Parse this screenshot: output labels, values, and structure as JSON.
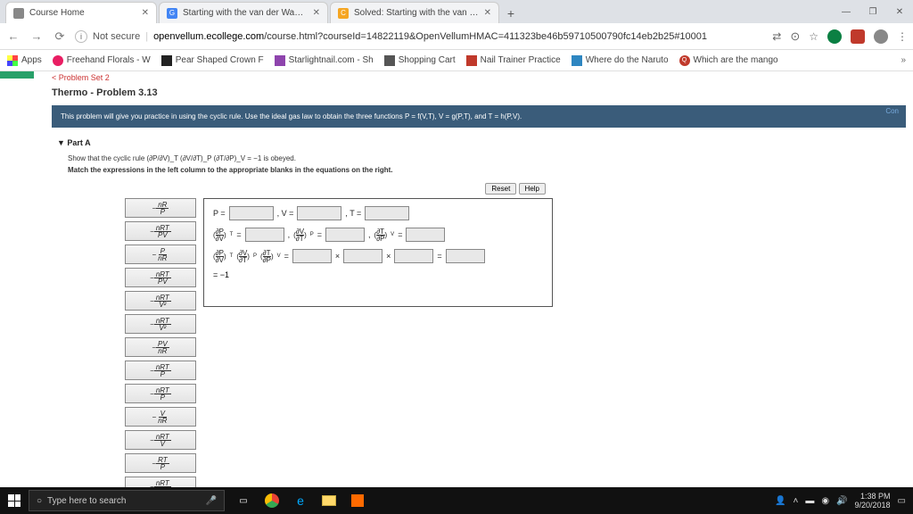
{
  "tabs": [
    {
      "label": "Course Home",
      "favicon": "#888"
    },
    {
      "label": "Starting with the van der Waals e",
      "favicon": "#4285f4"
    },
    {
      "label": "Solved: Starting with the van der",
      "favicon": "#f5a623"
    }
  ],
  "window": {
    "min": "—",
    "max": "◻",
    "close": "✕",
    "restore": "❐"
  },
  "addr": {
    "notsecure_label": "Not secure",
    "url_domain": "openvellum.ecollege.com",
    "url_path": "/course.html?courseId=14822119&OpenVellumHMAC=411323be46b59710500790fc14eb2b25#10001"
  },
  "bookmarks": [
    {
      "label": "Apps",
      "color": "#4285f4"
    },
    {
      "label": "Freehand Florals - W",
      "color": "#e91e63"
    },
    {
      "label": "Pear Shaped Crown F",
      "color": "#222"
    },
    {
      "label": "Starlightnail.com - Sh",
      "color": "#8e44ad"
    },
    {
      "label": "Shopping Cart",
      "color": "#555"
    },
    {
      "label": "Nail Trainer Practice",
      "color": "#c0392b"
    },
    {
      "label": "Where do the Naruto",
      "color": "#2e86c1"
    },
    {
      "label": "Which are the mango",
      "color": "#c0392b"
    }
  ],
  "breadcrumb": "< Problem Set 2",
  "page_title": "Thermo - Problem 3.13",
  "bluebar_text": "This problem will give you practice in using the cyclic rule. Use the ideal gas law to obtain the three functions P = f(V,T), V = g(P,T), and T = h(P,V).",
  "bluebar_link": "Con",
  "partA": {
    "title": "Part A",
    "line1": "Show that the cyclic rule (∂P/∂V)_T (∂V/∂T)_P (∂T/∂P)_V = −1 is obeyed.",
    "line2": "Match the expressions in the left column to the appropriate blanks in the equations on the right.",
    "reset": "Reset",
    "help": "Help"
  },
  "tiles": [
    {
      "n": "nR",
      "d": "P"
    },
    {
      "n": "nRT",
      "d": "PV"
    },
    {
      "n": "P",
      "d": "nR"
    },
    {
      "n": "nRT",
      "d": "PV"
    },
    {
      "n": "nRT",
      "d": "V²"
    },
    {
      "n": "nRT",
      "d": "V²"
    },
    {
      "n": "PV",
      "d": "nR"
    },
    {
      "n": "nRT",
      "d": "P"
    },
    {
      "n": "nRT",
      "d": "P"
    },
    {
      "n": "V",
      "d": "nR"
    },
    {
      "n": "nRT",
      "d": "V"
    },
    {
      "n": "RT",
      "d": "P"
    },
    {
      "n": "nRT",
      "d": "V"
    }
  ],
  "eq": {
    "r1": {
      "a": "P =",
      "b": ", V =",
      "c": ", T ="
    },
    "r2": {
      "a": "∂P",
      "b": "∂V",
      "sT": "T",
      "c": "∂V",
      "d": "∂T",
      "sP": "P",
      "e": "∂T",
      "f": "∂P",
      "sV": "V"
    },
    "r3": {
      "pre": ",",
      "eqs": "= −1"
    }
  },
  "taskbar": {
    "search_placeholder": "Type here to search",
    "time": "1:38 PM",
    "date": "9/20/2018"
  },
  "chart_data": null
}
